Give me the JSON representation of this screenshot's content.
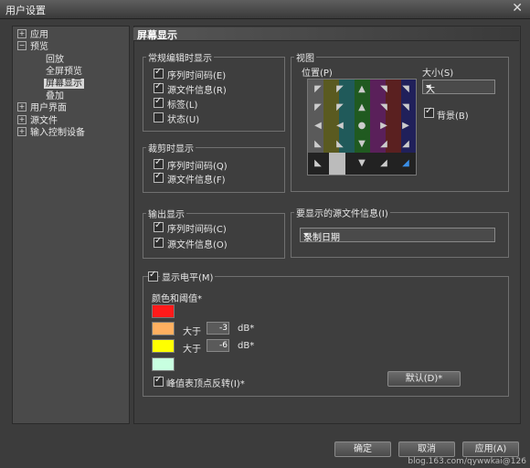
{
  "window": {
    "title": "用户设置",
    "close_label": "✕"
  },
  "tree": {
    "items": [
      {
        "label": "应用",
        "toggle": "+"
      },
      {
        "label": "预览",
        "toggle": "−"
      },
      {
        "label": "回放"
      },
      {
        "label": "全屏预览"
      },
      {
        "label": "屏幕显示",
        "selected": true
      },
      {
        "label": "叠加"
      },
      {
        "label": "用户界面",
        "toggle": "+"
      },
      {
        "label": "源文件",
        "toggle": "+"
      },
      {
        "label": "输入控制设备",
        "toggle": "+"
      }
    ]
  },
  "main": {
    "title": "屏幕显示",
    "normal": {
      "label": "常规编辑时显示",
      "items": [
        {
          "label": "序列时间码(E)",
          "checked": true
        },
        {
          "label": "源文件信息(R)",
          "checked": true
        },
        {
          "label": "标签(L)",
          "checked": true
        },
        {
          "label": "状态(U)",
          "checked": false
        }
      ]
    },
    "trim": {
      "label": "裁剪时显示",
      "items": [
        {
          "label": "序列时间码(Q)",
          "checked": true
        },
        {
          "label": "源文件信息(F)",
          "checked": true
        }
      ]
    },
    "output": {
      "label": "输出显示",
      "items": [
        {
          "label": "序列时间码(C)",
          "checked": true
        },
        {
          "label": "源文件信息(O)",
          "checked": true
        }
      ]
    },
    "view": {
      "label": "视图",
      "position_label": "位置(P)",
      "size_label": "大小(S)",
      "size_value": "大",
      "background_label": "背景(B)",
      "background_checked": true
    },
    "source_info": {
      "label": "要显示的源文件信息(I)",
      "value": "录制日期"
    },
    "level": {
      "label": "显示电平(M)",
      "checked": true,
      "color_threshold_label": "颜色和阈值*",
      "greater_label": "大于",
      "unit": "dB*",
      "threshold1": "-3",
      "threshold2": "-6",
      "colors": [
        "#ff1a1a",
        "#ffb060",
        "#ffff00",
        "#c8ffe0"
      ],
      "peak_label": "峰值表顶点反转(I)*",
      "peak_checked": true,
      "default_button": "默认(D)*"
    }
  },
  "footer": {
    "ok": "确定",
    "cancel": "取消",
    "apply": "应用(A)"
  },
  "watermark": "blog.163.com/qywwkai@126"
}
